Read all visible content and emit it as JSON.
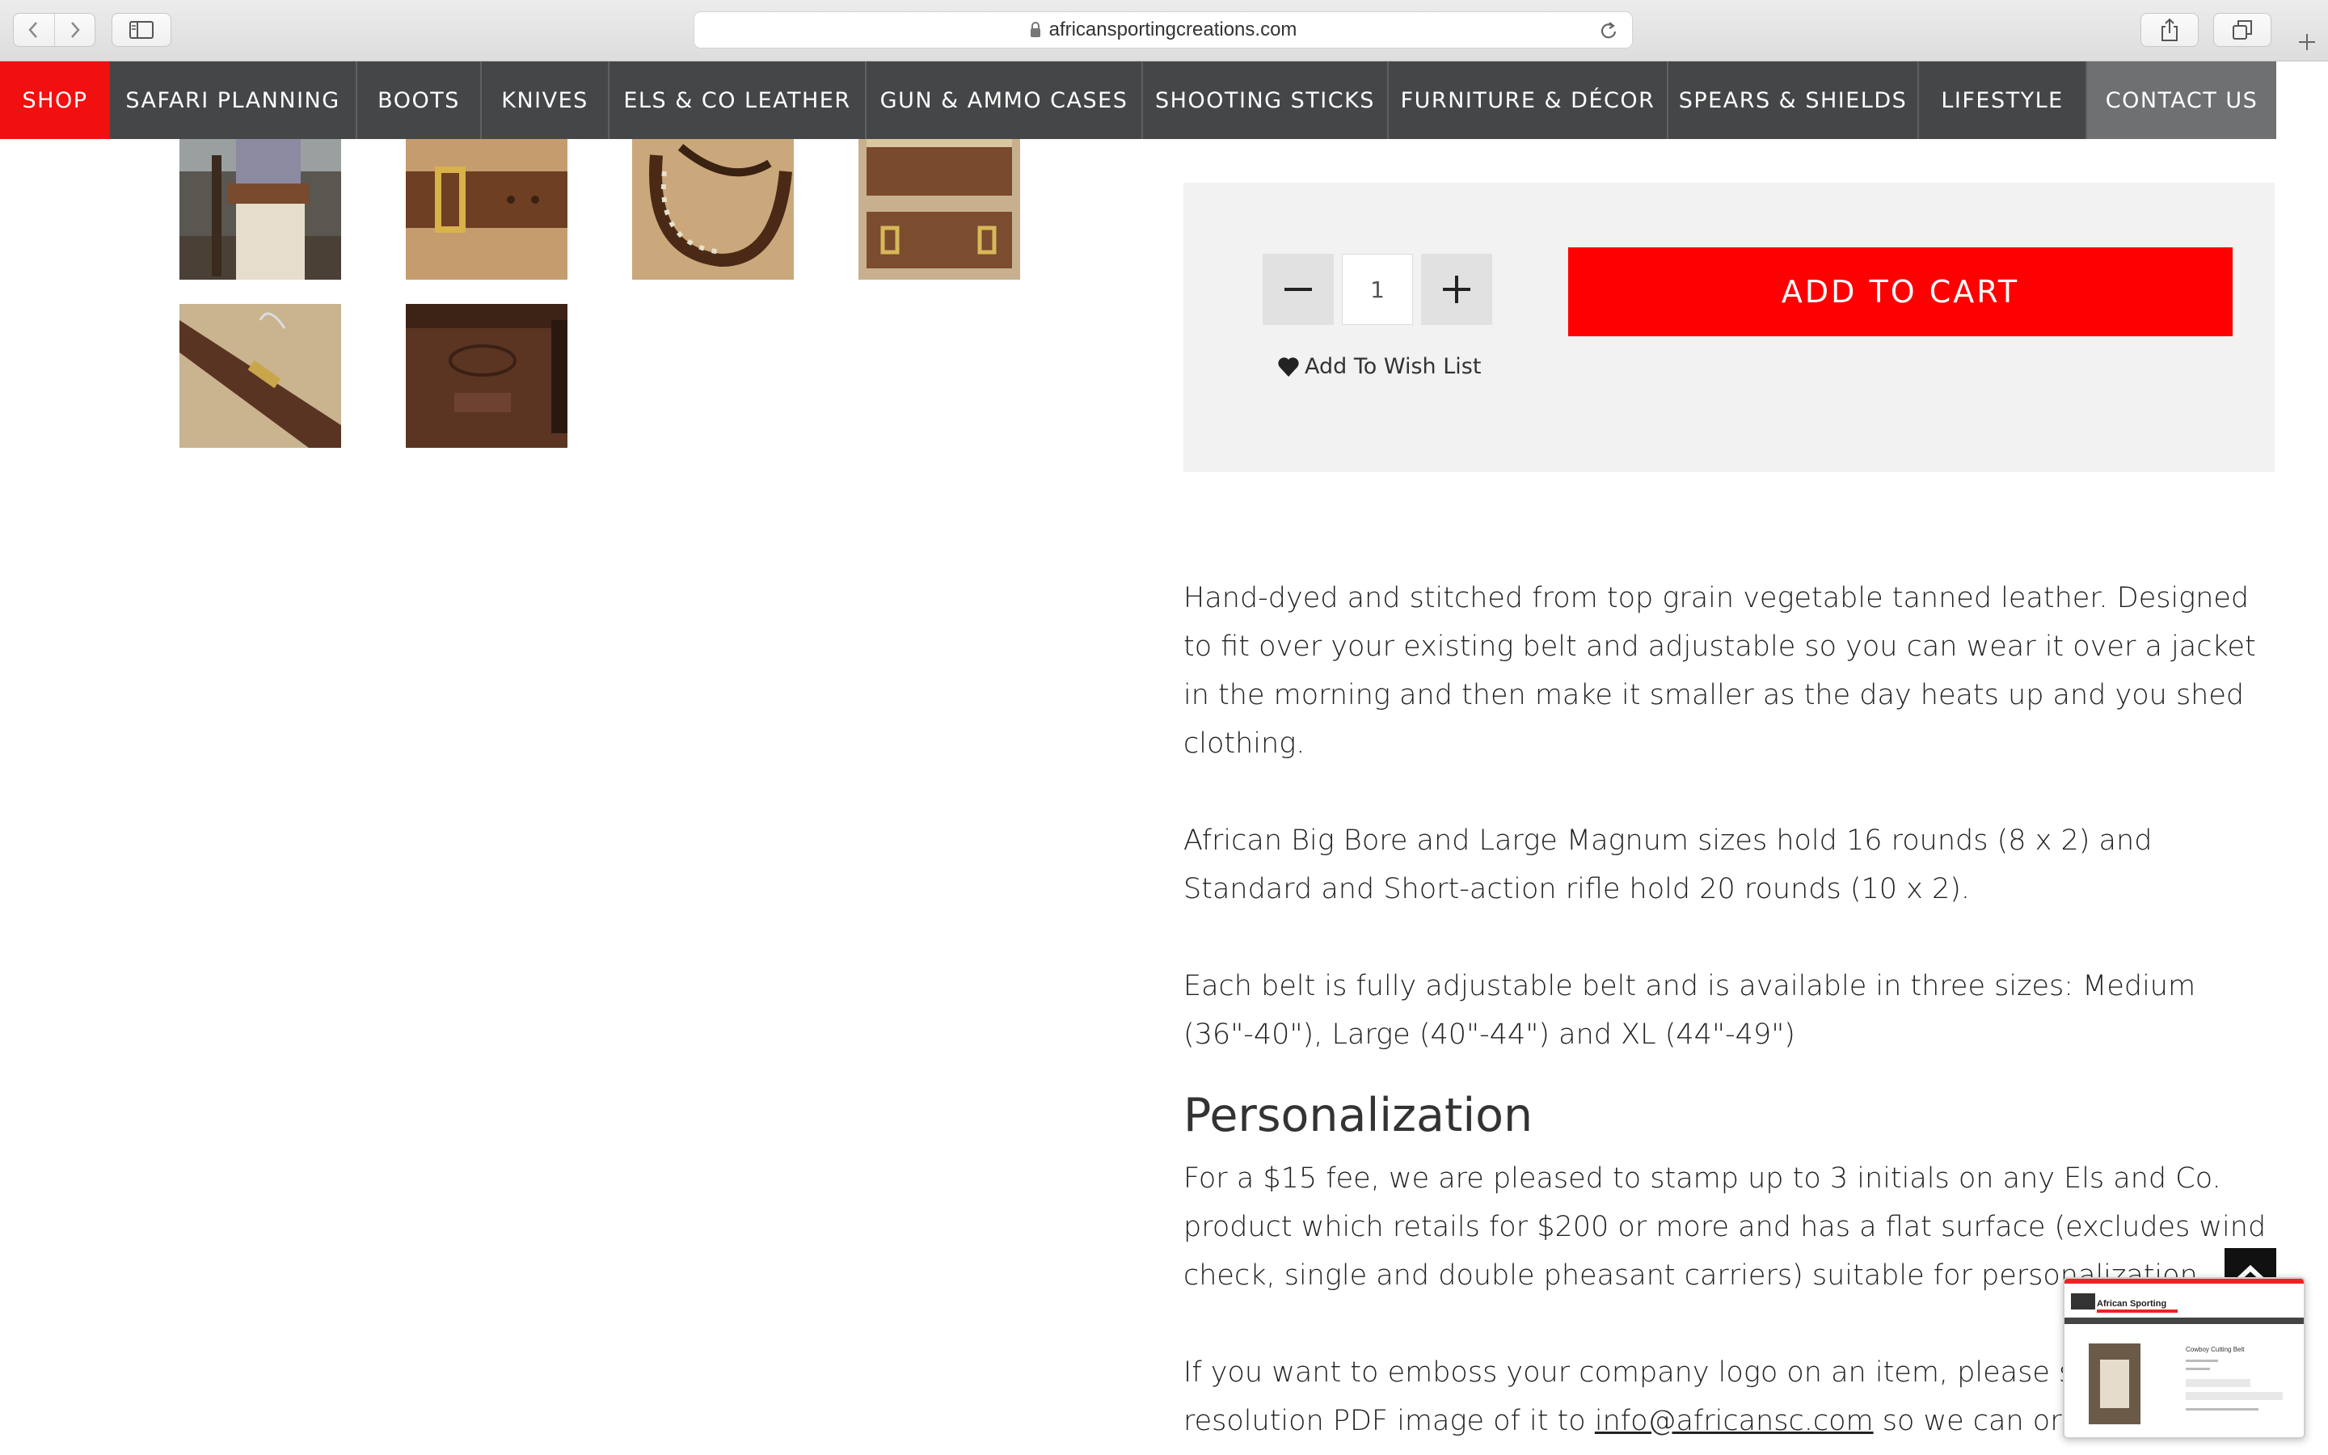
{
  "browser": {
    "url": "africansportingcreations.com",
    "icons": [
      "back-icon",
      "forward-icon",
      "sidebar-icon",
      "lock-icon",
      "reload-icon",
      "share-icon",
      "tabs-icon",
      "plus-icon"
    ]
  },
  "nav": {
    "items": [
      {
        "label": "SHOP"
      },
      {
        "label": "SAFARI PLANNING"
      },
      {
        "label": "BOOTS"
      },
      {
        "label": "KNIVES"
      },
      {
        "label": "ELS & CO LEATHER"
      },
      {
        "label": "GUN & AMMO CASES"
      },
      {
        "label": "SHOOTING STICKS"
      },
      {
        "label": "FURNITURE & DÉCOR"
      },
      {
        "label": "SPEARS & SHIELDS"
      },
      {
        "label": "LIFESTYLE"
      },
      {
        "label": "CONTACT US"
      }
    ],
    "colors": {
      "active": "#f20f0f",
      "default": "#444648",
      "contact": "#6e7072"
    }
  },
  "gallery": {
    "thumbnails": [
      "hunter-wearing-belt",
      "belt-brass-buckle",
      "belt-cartridge-loops",
      "cartridge-belt-open",
      "belt-strap-closeup",
      "embossed-initials-mwa"
    ]
  },
  "purchase": {
    "quantity": "1",
    "add_to_cart_label": "ADD TO CART",
    "wishlist_label": "Add To Wish List",
    "accent_color": "#fe0000"
  },
  "description": {
    "p1": "Hand-dyed and stitched from top grain vegetable tanned leather. Designed to fit over your existing belt and adjustable so you can wear it over a jacket in the morning and then make it smaller as the day heats up and you shed clothing.",
    "p2": "African Big Bore and Large Magnum sizes hold 16 rounds (8 x 2) and Standard and Short-action rifle hold 20 rounds (10 x 2).",
    "p3": "Each belt is fully adjustable belt and is available in three sizes: Medium (36\"-40\"), Large (40\"-44\") and XL (44\"-49\")",
    "heading": "Personalization",
    "p4": "For a $15 fee, we are pleased to stamp up to 3 initials on any Els and Co. product which retails for $200 or more and has a flat surface (excludes wind check, single and double pheasant carriers) suitable for personalization.",
    "p5_start": "If you want to emboss your company logo on an item, please send",
    "p5_line2_start": "resolution PDF image of it to",
    "email": "info@africansc.com",
    "p5_line2_end": "so we can order th"
  },
  "preview": {
    "brand": "African Sporting",
    "product_title": "Cowboy Cutting Belt"
  }
}
